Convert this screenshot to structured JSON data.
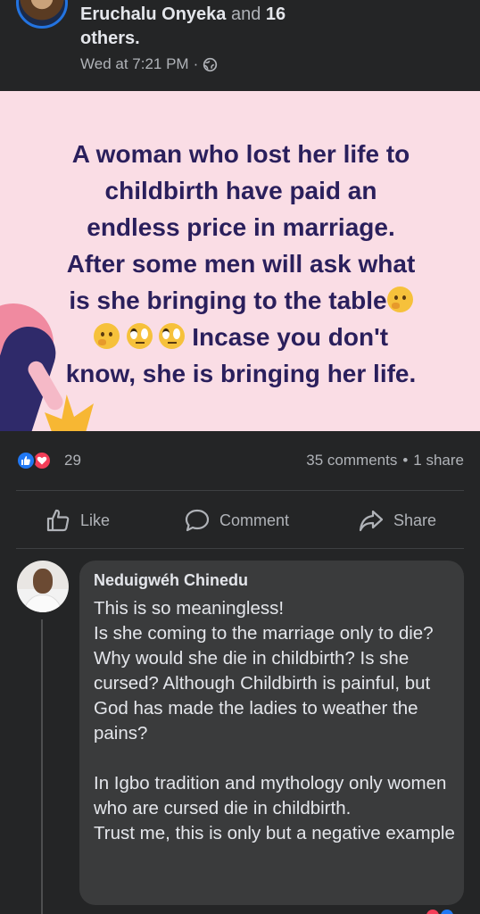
{
  "post": {
    "author_name": "Eruchalu Onyeka",
    "and_text": "and",
    "others_count": "16",
    "others_text": "others.",
    "timestamp": "Wed at 7:21 PM",
    "dot": "·",
    "privacy_icon": "globe-icon",
    "lines": [
      "A woman who lost her life to",
      "childbirth have paid an",
      "endless price in marriage.",
      "After some men will ask what",
      "is she bringing to the table",
      "Incase you don't",
      "know, she is bringing her life."
    ],
    "background_color": "#fadde5",
    "text_color": "#2a1f5c"
  },
  "reactions": {
    "icons": [
      "like-icon",
      "love-icon"
    ],
    "count": "29",
    "comments": "35 comments",
    "separator": "•",
    "shares": "1 share"
  },
  "actions": {
    "like": "Like",
    "comment": "Comment",
    "share": "Share"
  },
  "comment": {
    "author": "Neduigwéh Chinedu",
    "text": "This is so meaningless!\nIs she coming to the marriage only to die? Why would she die in childbirth? Is she cursed? Although Childbirth is painful, but God has made the ladies to weather the pains?\n\nIn Igbo tradition and mythology only women who are cursed die in childbirth.\nTrust me, this is only but a negative example"
  },
  "colors": {
    "background": "#242526",
    "bubble": "#3a3b3c",
    "secondary_text": "#b0b3b8",
    "like_blue": "#2078f4",
    "love_red": "#f33e58"
  }
}
